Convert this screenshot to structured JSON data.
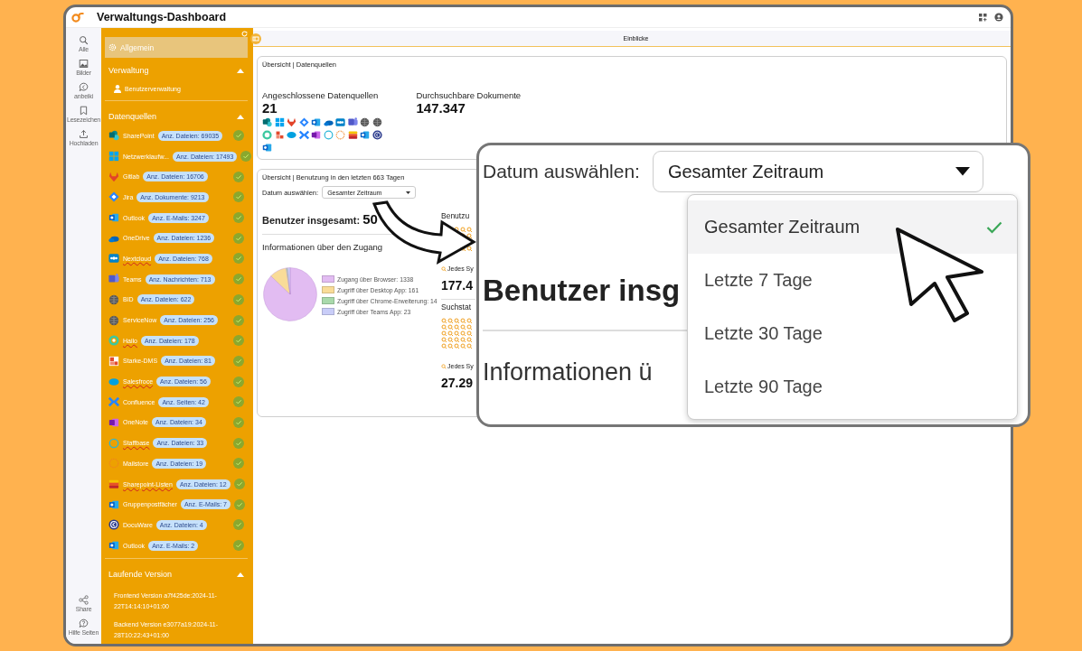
{
  "window": {
    "title": "Verwaltungs-Dashboard"
  },
  "rail": {
    "top": [
      {
        "label": "Alle"
      },
      {
        "label": "Bilder"
      },
      {
        "label": "anbeiki"
      },
      {
        "label": "Lesezeichen"
      },
      {
        "label": "Hochladen"
      }
    ],
    "bottom": [
      {
        "label": "Share"
      },
      {
        "label": "Hilfe Seiten"
      }
    ]
  },
  "sidebar": {
    "general": {
      "label": "Allgemein",
      "selected": true
    },
    "sections": [
      {
        "title": "Verwaltung",
        "expanded": true
      },
      {
        "title": "Datenquellen",
        "expanded": true
      },
      {
        "title": "Laufende Version",
        "expanded": true
      }
    ],
    "admin_items": [
      {
        "label": "Benutzerverwaltung"
      }
    ],
    "sources": [
      {
        "name": "SharePoint",
        "badge": "Anz. Dateien: 69035",
        "connected": true,
        "spelling_error": false
      },
      {
        "name": "Netzwerklaufw...",
        "badge": "Anz. Dateien: 17493",
        "connected": true,
        "spelling_error": false
      },
      {
        "name": "Gitlab",
        "badge": "Anz. Dateien: 16706",
        "connected": true,
        "spelling_error": false
      },
      {
        "name": "Jira",
        "badge": "Anz. Dokumente: 9213",
        "connected": true,
        "spelling_error": false
      },
      {
        "name": "Outlook",
        "badge": "Anz. E-Mails: 3247",
        "connected": true,
        "spelling_error": false
      },
      {
        "name": "OneDrive",
        "badge": "Anz. Dateien: 1236",
        "connected": true,
        "spelling_error": false
      },
      {
        "name": "Nextcloud",
        "badge": "Anz. Dateien: 768",
        "connected": true,
        "spelling_error": true
      },
      {
        "name": "Teams",
        "badge": "Anz. Nachrichten: 713",
        "connected": true,
        "spelling_error": false
      },
      {
        "name": "BID",
        "badge": "Anz. Dateien: 622",
        "connected": true,
        "spelling_error": false
      },
      {
        "name": "ServiceNow",
        "badge": "Anz. Dateien: 256",
        "connected": true,
        "spelling_error": false
      },
      {
        "name": "Hailo",
        "badge": "Anz. Dateien: 178",
        "connected": true,
        "spelling_error": true
      },
      {
        "name": "Starke-DMS",
        "badge": "Anz. Dateien: 81",
        "connected": true,
        "spelling_error": false
      },
      {
        "name": "Salesfroce",
        "badge": "Anz. Dateien: 56",
        "connected": true,
        "spelling_error": true
      },
      {
        "name": "Confluence",
        "badge": "Anz. Seiten: 42",
        "connected": true,
        "spelling_error": false
      },
      {
        "name": "OneNote",
        "badge": "Anz. Dateien: 34",
        "connected": true,
        "spelling_error": false
      },
      {
        "name": "Staffbase",
        "badge": "Anz. Dateien: 33",
        "connected": true,
        "spelling_error": true
      },
      {
        "name": "Mailstore",
        "badge": "Anz. Dateien: 19",
        "connected": true,
        "spelling_error": false
      },
      {
        "name": "Sharepoint-Listen",
        "badge": "Anz. Dateien: 12",
        "connected": true,
        "spelling_error": true
      },
      {
        "name": "Gruppenpostfächer",
        "badge": "Anz. E-Mails: 7",
        "connected": true,
        "spelling_error": false
      },
      {
        "name": "DocuWare",
        "badge": "Anz. Dateien: 4",
        "connected": true,
        "spelling_error": false
      },
      {
        "name": "Outlook",
        "badge": "Anz. E-Mails: 2",
        "connected": true,
        "spelling_error": false
      }
    ],
    "versions": [
      "Frontend Version a7f425de:2024-11-22T14:14:10+01:00",
      "Backend Version e3077a19:2024-11-28T10:22:43+01:00"
    ]
  },
  "tabs": [
    {
      "label": "Einblicke",
      "selected": true
    }
  ],
  "sources_card": {
    "title": "Übersicht | Datenquellen",
    "stats": [
      {
        "label": "Angeschlossene Datenquellen",
        "value": "21"
      },
      {
        "label": "Durchsuchbare Dokumente",
        "value": "147.347"
      }
    ]
  },
  "usage_card": {
    "title": "Übersicht | Benutzung in den letzten 663 Tagen",
    "date_label": "Datum auswählen:",
    "date_value": "Gesamter Zeitraum",
    "users_label": "Benutzer insgesamt:",
    "users_value": "50",
    "access_title": "Informationen über den Zugang",
    "chart_data": {
      "type": "pie",
      "categories": [
        "Zugang über Browser: 1338",
        "Zugriff über Desktop App: 161",
        "Zugriff über Chrome-Erweiterung: 14",
        "Zugriff über Teams App: 23"
      ],
      "values": [
        1338,
        161,
        14,
        23
      ],
      "legend": "right",
      "colors": [
        "#e2bcf2",
        "#f9dc98",
        "#a9d9ab",
        "#c9cdf8"
      ]
    },
    "columns": [
      {
        "title": "Benutzu",
        "caption": "Jedes Sy",
        "value": "177.4"
      },
      {
        "title": "Suchstat",
        "caption": "Jedes Sy",
        "value": "27.29"
      }
    ]
  },
  "callout": {
    "date_label": "Datum auswählen:",
    "date_value": "Gesamter Zeitraum",
    "heading_fragment": "Benutzer insg",
    "subheading_fragment": "Informationen ü",
    "options": [
      {
        "label": "Gesamter Zeitraum",
        "selected": true
      },
      {
        "label": "Letzte 7 Tage",
        "selected": false
      },
      {
        "label": "Letzte 30 Tage",
        "selected": false
      },
      {
        "label": "Letzte 90 Tage",
        "selected": false
      }
    ]
  }
}
